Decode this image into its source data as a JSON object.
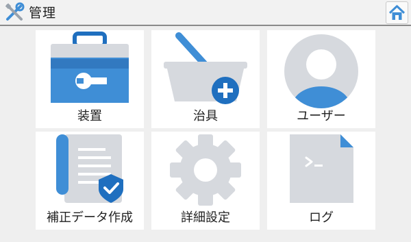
{
  "header": {
    "title": "管理",
    "app_icon": "tools-icon",
    "home_icon": "home-icon"
  },
  "tiles": [
    {
      "label": "装置",
      "icon": "toolbox-icon"
    },
    {
      "label": "治具",
      "icon": "basket-add-icon"
    },
    {
      "label": "ユーザー",
      "icon": "user-icon"
    },
    {
      "label": "補正データ作成",
      "icon": "document-check-icon"
    },
    {
      "label": "詳細設定",
      "icon": "gear-icon"
    },
    {
      "label": "ログ",
      "icon": "terminal-file-icon"
    }
  ],
  "colors": {
    "accent_blue": "#3f8ed6",
    "dark_blue": "#1f6fbf",
    "icon_gray": "#d6d9de",
    "background": "#efefef"
  }
}
